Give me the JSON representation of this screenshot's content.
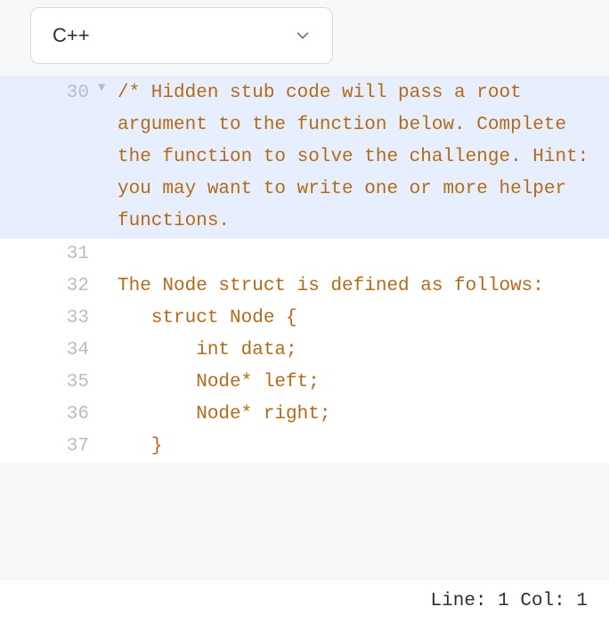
{
  "toolbar": {
    "language": "C++"
  },
  "editor": {
    "lines": [
      {
        "num": 30,
        "fold": "▼",
        "highlight": true,
        "text": "/* Hidden stub code will pass a root argument to the function below. Complete the function to solve the challenge. Hint: you may want to write one or more helper functions. "
      },
      {
        "num": 31,
        "fold": "",
        "highlight": false,
        "text": ""
      },
      {
        "num": 32,
        "fold": "",
        "highlight": false,
        "text": "The Node struct is defined as follows:"
      },
      {
        "num": 33,
        "fold": "",
        "highlight": false,
        "text": "   struct Node {"
      },
      {
        "num": 34,
        "fold": "",
        "highlight": false,
        "text": "       int data;"
      },
      {
        "num": 35,
        "fold": "",
        "highlight": false,
        "text": "       Node* left;"
      },
      {
        "num": 36,
        "fold": "",
        "highlight": false,
        "text": "       Node* right;"
      },
      {
        "num": 37,
        "fold": "",
        "highlight": false,
        "text": "   }"
      }
    ]
  },
  "status": {
    "line_label": "Line:",
    "line": 1,
    "col_label": "Col:",
    "col": 1
  }
}
